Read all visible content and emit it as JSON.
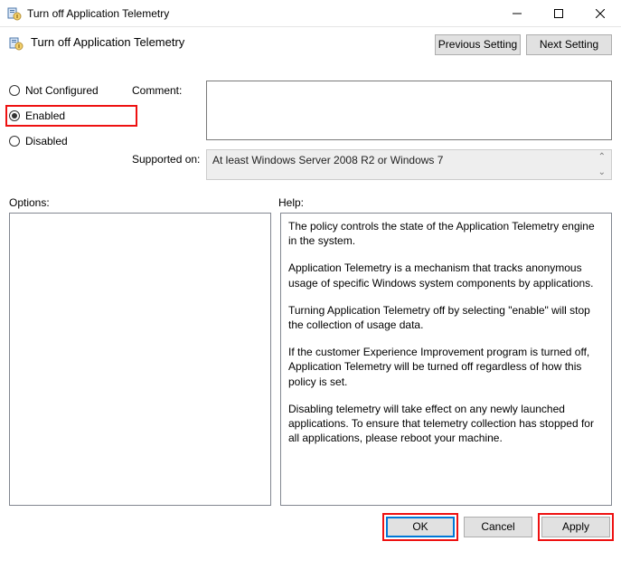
{
  "window": {
    "title": "Turn off Application Telemetry"
  },
  "header": {
    "heading": "Turn off Application Telemetry",
    "prev": "Previous Setting",
    "next": "Next Setting"
  },
  "state": {
    "notConfigured": "Not Configured",
    "enabled": "Enabled",
    "disabled": "Disabled",
    "selected": "enabled"
  },
  "labels": {
    "comment": "Comment:",
    "supportedOn": "Supported on:",
    "options": "Options:",
    "help": "Help:"
  },
  "supportedOn": "At least Windows Server 2008 R2 or Windows 7",
  "comment": "",
  "help": {
    "p1": "The policy controls the state of the Application Telemetry engine in the system.",
    "p2": "Application Telemetry is a mechanism that tracks anonymous usage of specific Windows system components by applications.",
    "p3": "Turning Application Telemetry off by selecting \"enable\" will stop the collection of usage data.",
    "p4": "If the customer Experience Improvement program is turned off, Application Telemetry will be turned off regardless of how this policy is set.",
    "p5": "Disabling telemetry will take effect on any newly launched applications. To ensure that telemetry collection has stopped for all applications, please reboot your machine."
  },
  "buttons": {
    "ok": "OK",
    "cancel": "Cancel",
    "apply": "Apply"
  }
}
